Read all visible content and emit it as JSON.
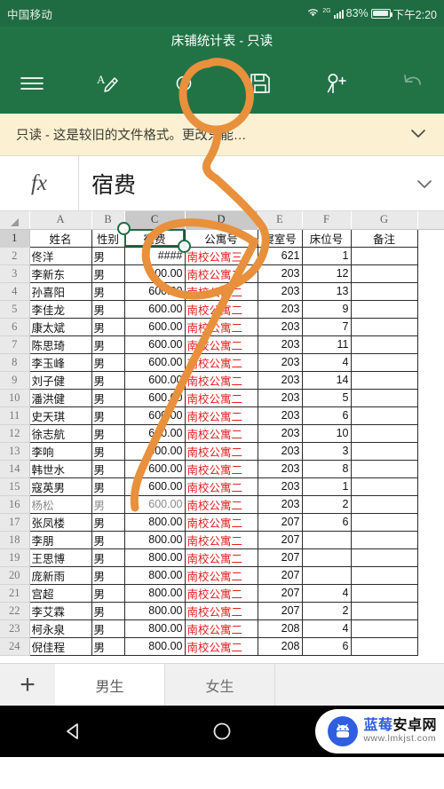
{
  "status_bar": {
    "carrier": "中国移动",
    "network_label": "2G",
    "battery_percent": "83%",
    "time": "下午2:20",
    "icons": [
      "wifi-icon",
      "signal-bars-icon",
      "battery-icon"
    ]
  },
  "title_bar": {
    "title": "床铺统计表 - 只读"
  },
  "toolbar": {
    "menu_label": "",
    "items": [
      {
        "name": "hamburger-menu-icon",
        "label": ""
      },
      {
        "name": "edit-pencil-icon",
        "label": ""
      },
      {
        "name": "circle-icon",
        "label": ""
      },
      {
        "name": "save-icon",
        "label": ""
      },
      {
        "name": "add-person-icon",
        "label": ""
      },
      {
        "name": "undo-icon",
        "label": ""
      }
    ]
  },
  "banner": {
    "message": "只读 - 这是较旧的文件格式。更改只能…",
    "expand_icon": "chevron-down-icon"
  },
  "formula_bar": {
    "fx_label": "fx",
    "value": "宿费",
    "expand_icon": "chevron-down-icon"
  },
  "grid": {
    "selected_cell": "C1",
    "selected_column": "C",
    "column_headers": [
      "A",
      "B",
      "C",
      "D",
      "E",
      "F",
      "G"
    ],
    "header_row_number": "1",
    "headers": [
      "姓名",
      "性别",
      "宿费",
      "公寓号",
      "寝室号",
      "床位号",
      "备注"
    ],
    "rows": [
      {
        "n": "2",
        "name": "佟洋",
        "gender": "男",
        "fee": "####",
        "apt": "南校公寓三",
        "room": "621",
        "bed": "1",
        "note": ""
      },
      {
        "n": "3",
        "name": "李新东",
        "gender": "男",
        "fee": "600.00",
        "apt": "南校公寓二",
        "room": "203",
        "bed": "12",
        "note": ""
      },
      {
        "n": "4",
        "name": "孙喜阳",
        "gender": "男",
        "fee": "600.00",
        "apt": "南校公寓二",
        "room": "203",
        "bed": "13",
        "note": ""
      },
      {
        "n": "5",
        "name": "李佳龙",
        "gender": "男",
        "fee": "600.00",
        "apt": "南校公寓二",
        "room": "203",
        "bed": "9",
        "note": ""
      },
      {
        "n": "6",
        "name": "康太斌",
        "gender": "男",
        "fee": "600.00",
        "apt": "南校公寓二",
        "room": "203",
        "bed": "7",
        "note": ""
      },
      {
        "n": "7",
        "name": "陈思琦",
        "gender": "男",
        "fee": "600.00",
        "apt": "南校公寓二",
        "room": "203",
        "bed": "11",
        "note": ""
      },
      {
        "n": "8",
        "name": "李玉峰",
        "gender": "男",
        "fee": "600.00",
        "apt": "南校公寓二",
        "room": "203",
        "bed": "4",
        "note": ""
      },
      {
        "n": "9",
        "name": "刘子健",
        "gender": "男",
        "fee": "600.00",
        "apt": "南校公寓二",
        "room": "203",
        "bed": "14",
        "note": ""
      },
      {
        "n": "10",
        "name": "潘洪健",
        "gender": "男",
        "fee": "600.00",
        "apt": "南校公寓二",
        "room": "203",
        "bed": "5",
        "note": ""
      },
      {
        "n": "11",
        "name": "史天琪",
        "gender": "男",
        "fee": "600.00",
        "apt": "南校公寓二",
        "room": "203",
        "bed": "6",
        "note": ""
      },
      {
        "n": "12",
        "name": "徐志航",
        "gender": "男",
        "fee": "600.00",
        "apt": "南校公寓二",
        "room": "203",
        "bed": "10",
        "note": ""
      },
      {
        "n": "13",
        "name": "李响",
        "gender": "男",
        "fee": "600.00",
        "apt": "南校公寓二",
        "room": "203",
        "bed": "3",
        "note": ""
      },
      {
        "n": "14",
        "name": "韩世水",
        "gender": "男",
        "fee": "600.00",
        "apt": "南校公寓二",
        "room": "203",
        "bed": "8",
        "note": ""
      },
      {
        "n": "15",
        "name": "寇英男",
        "gender": "男",
        "fee": "600.00",
        "apt": "南校公寓二",
        "room": "203",
        "bed": "1",
        "note": ""
      },
      {
        "n": "16",
        "name": "杨松",
        "gender": "男",
        "fee": "600.00",
        "apt": "南校公寓二",
        "room": "203",
        "bed": "2",
        "note": ""
      },
      {
        "n": "17",
        "name": "张凤楼",
        "gender": "男",
        "fee": "800.00",
        "apt": "南校公寓二",
        "room": "207",
        "bed": "6",
        "note": ""
      },
      {
        "n": "18",
        "name": "李朋",
        "gender": "男",
        "fee": "800.00",
        "apt": "南校公寓二",
        "room": "207",
        "bed": "",
        "note": ""
      },
      {
        "n": "19",
        "name": "王思博",
        "gender": "男",
        "fee": "800.00",
        "apt": "南校公寓二",
        "room": "207",
        "bed": "",
        "note": ""
      },
      {
        "n": "20",
        "name": "庞新雨",
        "gender": "男",
        "fee": "800.00",
        "apt": "南校公寓二",
        "room": "207",
        "bed": "",
        "note": ""
      },
      {
        "n": "21",
        "name": "宫超",
        "gender": "男",
        "fee": "800.00",
        "apt": "南校公寓二",
        "room": "207",
        "bed": "4",
        "note": ""
      },
      {
        "n": "22",
        "name": "李艾霖",
        "gender": "男",
        "fee": "800.00",
        "apt": "南校公寓二",
        "room": "207",
        "bed": "2",
        "note": ""
      },
      {
        "n": "23",
        "name": "柯永泉",
        "gender": "男",
        "fee": "800.00",
        "apt": "南校公寓二",
        "room": "208",
        "bed": "4",
        "note": ""
      },
      {
        "n": "24",
        "name": "倪佳程",
        "gender": "男",
        "fee": "800.00",
        "apt": "南校公寓二",
        "room": "208",
        "bed": "6",
        "note": ""
      }
    ]
  },
  "sheet_tabs": {
    "add_label": "+",
    "tabs": [
      {
        "label": "男生",
        "active": true
      },
      {
        "label": "女生",
        "active": false
      }
    ]
  },
  "nav_bar": {
    "icons": [
      "back-triangle-icon",
      "home-circle-icon",
      "recents-square-icon"
    ]
  },
  "watermark": {
    "site_name_blue": "蓝莓",
    "site_name_black": "安卓网",
    "url": "www.lmkjst.com"
  },
  "colors": {
    "excel_green": "#217346",
    "status_green": "#1f6b42",
    "banner_yellow": "#fcf0d2",
    "ink_orange": "#e8903c",
    "red_text": "#e02020",
    "watermark_blue": "#2f5fe0"
  }
}
